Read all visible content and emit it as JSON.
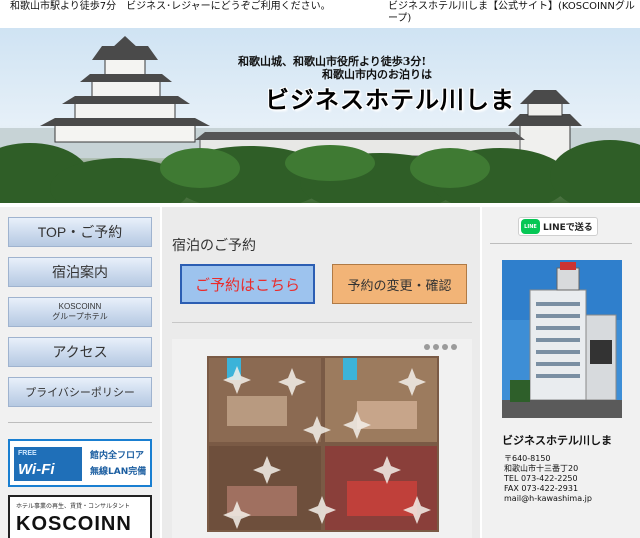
{
  "topbar": {
    "left_text": "和歌山市駅より徒歩7分　ビジネス･レジャーにどうぞご利用ください。",
    "right_text": "ビジネスホテル川しま【公式サイト】(KOSCOINNグループ)"
  },
  "banner": {
    "tagline_1": "和歌山城、和歌山市役所より徒歩3分!",
    "tagline_2": "和歌山市内のお泊りは",
    "hotel_name": "ビジネスホテル川しま"
  },
  "sidebar": {
    "items": [
      {
        "label": "TOP・ご予約"
      },
      {
        "label": "宿泊案内"
      },
      {
        "label": "KOSCOINN",
        "label2": "グループホテル"
      },
      {
        "label": "アクセス"
      },
      {
        "label": "プライバシーポリシー"
      }
    ],
    "wifi": {
      "free": "FREE",
      "brand": "Wi-Fi",
      "line1": "館内全フロア",
      "line2": "無線LAN完備"
    },
    "koscoinn": {
      "subtitle": "ホテル事業の再生、賃貸・コンサルタント",
      "name": "KOSCOINN"
    }
  },
  "main": {
    "title": "宿泊のご予約",
    "reserve_button": "ご予約はこちら",
    "change_button": "予約の変更・確認"
  },
  "right": {
    "line_button": "LINEで送る",
    "line_logo": "LINE",
    "hotel_name": "ビジネスホテル川しま",
    "postal": "〒640-8150",
    "address": "和歌山市十三番丁20",
    "tel": "TEL 073-422-2250",
    "fax": "FAX 073-422-2931",
    "mail": "mail@h-kawashima.jp"
  },
  "colors": {
    "nav_button": "#c9d8ec",
    "reserve_bg": "#9dc3ee",
    "reserve_text": "#ea2b2b",
    "change_bg": "#f2b477",
    "line_green": "#06c755"
  }
}
